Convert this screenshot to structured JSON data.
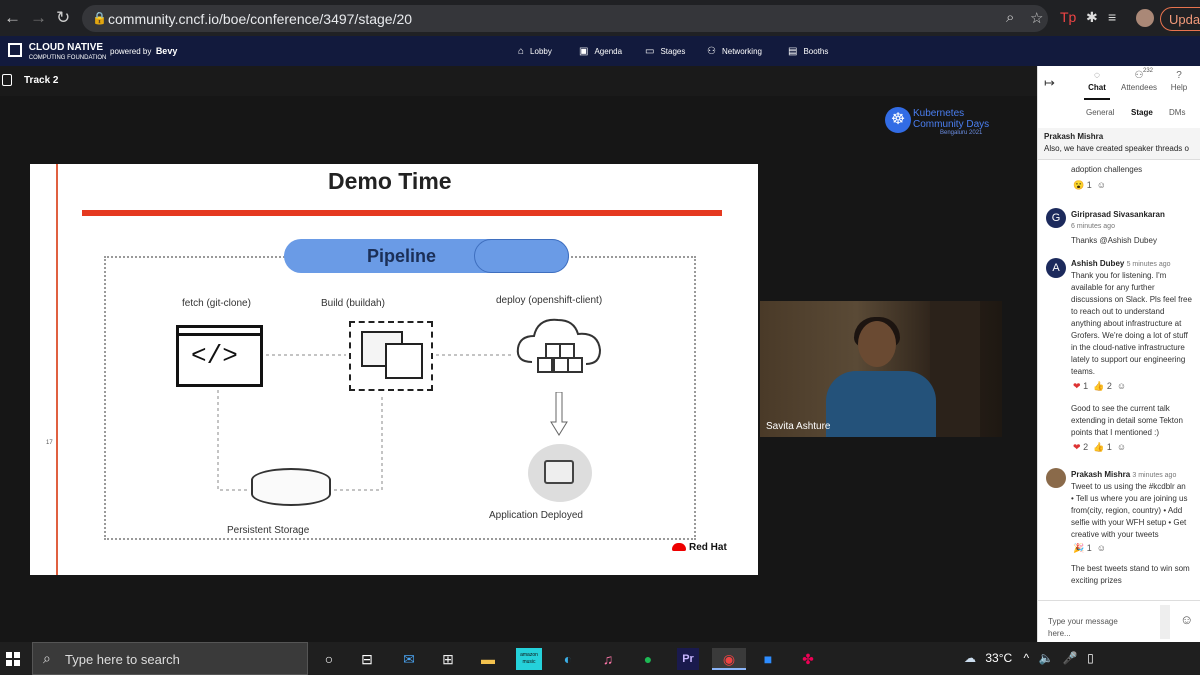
{
  "browser": {
    "url": "community.cncf.io/boe/conference/3497/stage/20",
    "update_label": "Update"
  },
  "app": {
    "brand_line1": "CLOUD NATIVE",
    "brand_line2": "COMPUTING FOUNDATION",
    "powered_by": "powered by",
    "powered_brand": "Bevy",
    "nav": [
      "Lobby",
      "Agenda",
      "Stages",
      "Networking",
      "Booths"
    ]
  },
  "track": {
    "title": "Track 2"
  },
  "stage": {
    "kcd_line1": "Kubernetes",
    "kcd_line2": "Community Days",
    "kcd_line3": "Bengaluru 2021",
    "slide": {
      "title": "Demo Time",
      "page_no": "17",
      "pipeline": "Pipeline",
      "fetch": "fetch (git-clone)",
      "build": "Build (buildah)",
      "deploy": "deploy (openshift-client)",
      "storage": "Persistent Storage",
      "app_deployed": "Application Deployed",
      "redhat": "Red Hat",
      "code": "</>"
    },
    "speaker_name": "Savita Ashture"
  },
  "panel": {
    "tabs": [
      {
        "label": "Chat",
        "icon": "chat-icon"
      },
      {
        "label": "Attendees",
        "icon": "people-icon",
        "count": "232"
      },
      {
        "label": "Help",
        "icon": "help-icon"
      }
    ],
    "subtabs": [
      "General",
      "Stage",
      "DMs"
    ],
    "pinned": {
      "author": "Prakash Mishra",
      "text": "Also, we have created speaker threads o"
    },
    "fragment": "adoption challenges",
    "messages": [
      {
        "initial": "G",
        "author": "Giriprasad Sivasankaran",
        "time": "6 minutes ago",
        "text": "Thanks @Ashish Dubey"
      },
      {
        "initial": "A",
        "author": "Ashish Dubey",
        "time": "5 minutes ago",
        "text": "Thank you for listening. I'm\navailable for any further\ndiscussions on Slack. Pls feel free\nto reach out to understand\nanything about infrastructure at\nGrofers. We're doing a lot of stuff\nin the cloud-native infrastructure\nlately to support our engineering\nteams."
      },
      {
        "text": "Good to see the current talk\nextending in detail some Tekton\npoints that I mentioned :)"
      },
      {
        "author": "Prakash Mishra",
        "time": "3 minutes ago",
        "text": "Tweet to us using the #kcdblr an\n• Tell us where you are joining us\nfrom(city, region, country) • Add\nselfie with your WFH setup • Get\ncreative with your tweets"
      },
      {
        "text": "The best tweets stand to win som\nexciting prizes"
      }
    ],
    "reactions": {
      "r1": "1",
      "r2a": "1",
      "r2b": "2",
      "r3a": "2",
      "r3b": "1",
      "r4": "1"
    },
    "input_placeholder": "Type your message here..."
  },
  "taskbar": {
    "search_placeholder": "Type here to search",
    "temperature": "33°C",
    "amazon_label": "amazon music",
    "pr_label": "Pr"
  }
}
